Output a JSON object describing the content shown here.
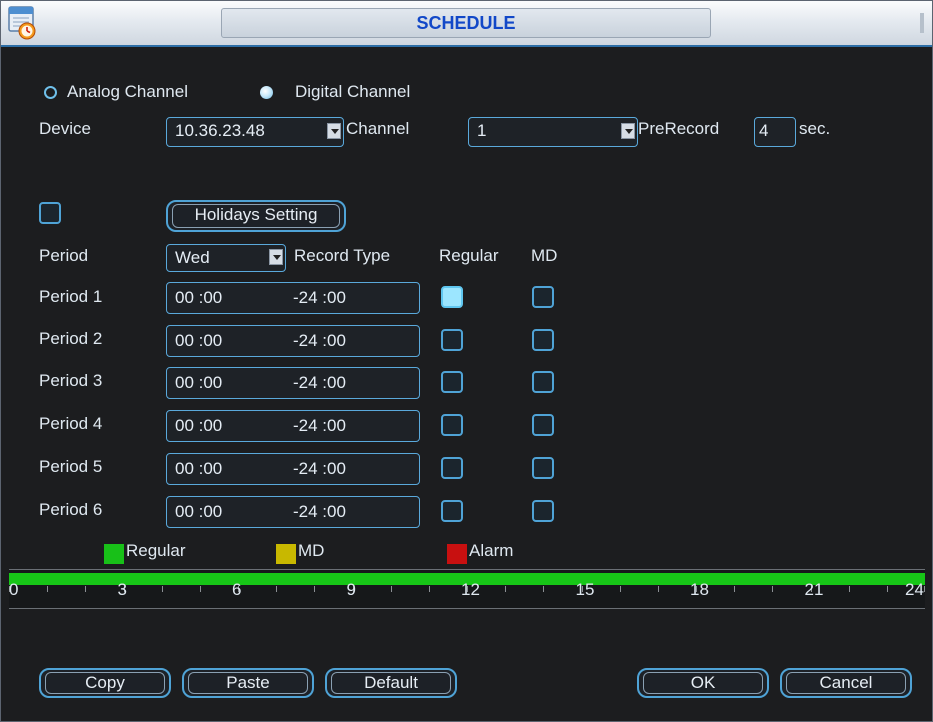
{
  "window": {
    "title": "SCHEDULE",
    "icon": "schedule-calendar-clock-icon"
  },
  "channel_type": {
    "analog_label": "Analog Channel",
    "digital_label": "Digital Channel",
    "selected": "digital"
  },
  "device": {
    "label": "Device",
    "value": "10.36.23.48"
  },
  "channel": {
    "label": "Channel",
    "value": "1"
  },
  "prerecord": {
    "label": "PreRecord",
    "value": "4",
    "unit": "sec."
  },
  "holidays": {
    "checked": false,
    "button_label": "Holidays Setting"
  },
  "period_header": {
    "label": "Period",
    "day": "Wed",
    "record_type_label": "Record Type",
    "regular_label": "Regular",
    "md_label": "MD"
  },
  "periods": [
    {
      "label": "Period 1",
      "start": "00 :00",
      "end": "-24 :00",
      "regular": true,
      "md": false
    },
    {
      "label": "Period 2",
      "start": "00 :00",
      "end": "-24 :00",
      "regular": false,
      "md": false
    },
    {
      "label": "Period 3",
      "start": "00 :00",
      "end": "-24 :00",
      "regular": false,
      "md": false
    },
    {
      "label": "Period 4",
      "start": "00 :00",
      "end": "-24 :00",
      "regular": false,
      "md": false
    },
    {
      "label": "Period 5",
      "start": "00 :00",
      "end": "-24 :00",
      "regular": false,
      "md": false
    },
    {
      "label": "Period 6",
      "start": "00 :00",
      "end": "-24 :00",
      "regular": false,
      "md": false
    }
  ],
  "legend": [
    {
      "label": "Regular",
      "color": "#18c018"
    },
    {
      "label": "MD",
      "color": "#c8b800"
    },
    {
      "label": "Alarm",
      "color": "#c81010"
    }
  ],
  "timeline": {
    "hours": [
      "0",
      "3",
      "6",
      "9",
      "12",
      "15",
      "18",
      "21",
      "24"
    ],
    "fill_color": "#17c617",
    "regular_start_hour": 0,
    "regular_end_hour": 24
  },
  "buttons": {
    "copy": "Copy",
    "paste": "Paste",
    "default": "Default",
    "ok": "OK",
    "cancel": "Cancel"
  },
  "colors": {
    "accent_border": "#4fa3d6",
    "title_text": "#1248c8",
    "background": "#1c1d1f"
  }
}
